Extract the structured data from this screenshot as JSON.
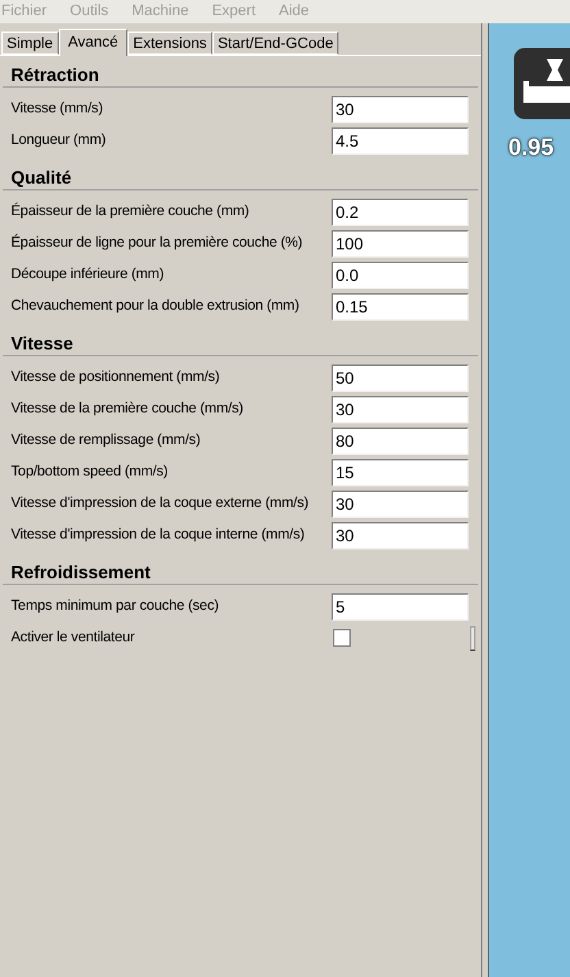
{
  "menu": [
    {
      "label": "Fichier",
      "disabled": true
    },
    {
      "label": "Outils",
      "disabled": true
    },
    {
      "label": "Machine",
      "disabled": true
    },
    {
      "label": "Expert",
      "disabled": true
    },
    {
      "label": "Aide",
      "disabled": true
    }
  ],
  "tabs": [
    {
      "label": "Simple",
      "selected": false
    },
    {
      "label": "Avancé",
      "selected": true
    },
    {
      "label": "Extensions",
      "selected": false
    },
    {
      "label": "Start/End-GCode",
      "selected": false
    }
  ],
  "sections": [
    {
      "title": "Rétraction",
      "rows": [
        {
          "kind": "text",
          "label": "Vitesse (mm/s)",
          "value": "30"
        },
        {
          "kind": "text",
          "label": "Longueur (mm)",
          "value": "4.5"
        }
      ]
    },
    {
      "title": "Qualité",
      "rows": [
        {
          "kind": "text",
          "label": "Épaisseur de la première couche (mm)",
          "value": "0.2"
        },
        {
          "kind": "text",
          "label": "Épaisseur de ligne pour la première couche (%)",
          "value": "100"
        },
        {
          "kind": "text",
          "label": "Découpe inférieure (mm)",
          "value": "0.0"
        },
        {
          "kind": "text",
          "label": "Chevauchement pour la double extrusion (mm)",
          "value": "0.15"
        }
      ]
    },
    {
      "title": "Vitesse",
      "rows": [
        {
          "kind": "text",
          "label": "Vitesse de positionnement (mm/s)",
          "value": "50"
        },
        {
          "kind": "text",
          "label": "Vitesse de la première couche (mm/s)",
          "value": "30"
        },
        {
          "kind": "text",
          "label": "Vitesse de remplissage (mm/s)",
          "value": "80"
        },
        {
          "kind": "text",
          "label": "Top/bottom speed (mm/s)",
          "value": "15"
        },
        {
          "kind": "text",
          "label": "Vitesse d'impression de la coque externe (mm/s)",
          "value": "30"
        },
        {
          "kind": "text",
          "label": "Vitesse d'impression de la coque interne (mm/s)",
          "value": "30"
        }
      ]
    },
    {
      "title": "Refroidissement",
      "rows": [
        {
          "kind": "text",
          "label": "Temps minimum par couche (sec)",
          "value": "5"
        },
        {
          "kind": "checkbox",
          "label": "Activer le ventilateur",
          "checked": false
        }
      ]
    }
  ],
  "preview": {
    "reading": "0.95"
  }
}
